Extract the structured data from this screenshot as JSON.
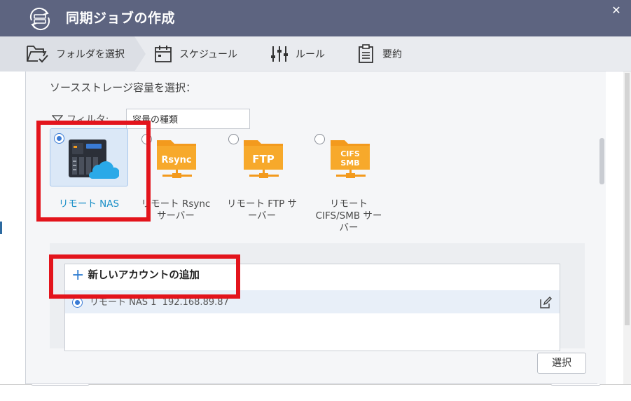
{
  "window": {
    "title": "同期ジョブの作成",
    "close_glyph": "✕"
  },
  "steps": [
    {
      "label": "フォルダを選択",
      "icon": "folder-check-icon",
      "active": true
    },
    {
      "label": "スケジュール",
      "icon": "calendar-icon",
      "active": false
    },
    {
      "label": "ルール",
      "icon": "sliders-icon",
      "active": false
    },
    {
      "label": "要約",
      "icon": "clipboard-icon",
      "active": false
    }
  ],
  "source": {
    "heading": "ソースストレージ容量を選択：",
    "filter_label": "フィルタ:",
    "filter_value": "容量の種類"
  },
  "options": [
    {
      "label": "リモート NAS",
      "icon": "nas-cloud-icon",
      "selected": true
    },
    {
      "label_line1": "リモート Rsync",
      "label_line2": "サーバー",
      "icon_text": "Rsync",
      "icon": "rsync-folder-icon",
      "selected": false
    },
    {
      "label_line1": "リモート FTP サ",
      "label_line2": "ーバー",
      "icon_text": "FTP",
      "icon": "ftp-folder-icon",
      "selected": false
    },
    {
      "label_line1": "リモート",
      "label_line2": "CIFS/SMB サー",
      "label_line3": "バー",
      "icon_text_1": "CIFS",
      "icon_text_2": "SMB",
      "icon": "cifs-smb-folder-icon",
      "selected": false
    }
  ],
  "accounts": {
    "add_label": "新しいアカウントの追加",
    "items": [
      {
        "name": "リモート NAS 1",
        "ip": "192.168.89.87",
        "selected": true
      }
    ]
  },
  "footer": {
    "select_label": "選択"
  },
  "colors": {
    "titlebar": "#5d6480",
    "accent": "#3a7bd5",
    "highlight_red": "#e3141c",
    "folder_orange": "#f39a1d",
    "selected_label": "#1a8fc7"
  }
}
